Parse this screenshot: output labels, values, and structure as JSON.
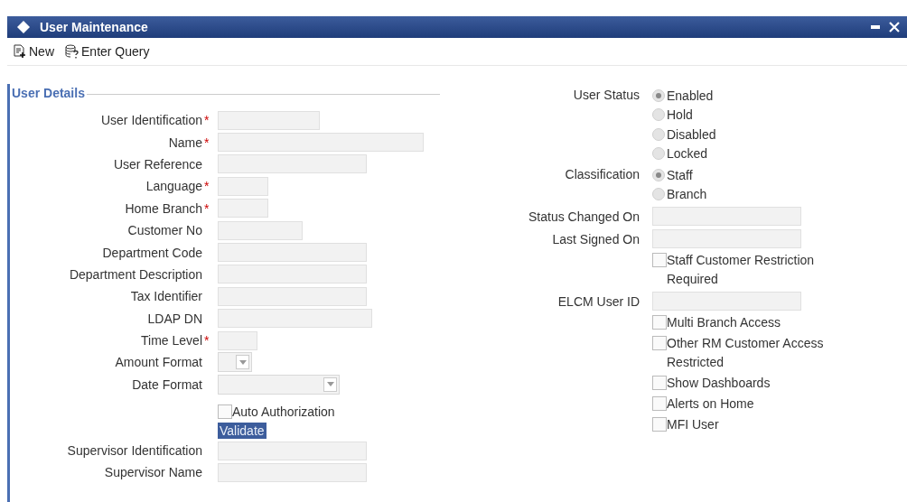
{
  "window": {
    "title": "User Maintenance"
  },
  "toolbar": [
    {
      "kind": "new",
      "label": "New"
    },
    {
      "kind": "query",
      "label": "Enter Query"
    }
  ],
  "section": {
    "title": "User Details"
  },
  "left_fields": [
    {
      "kind": "text",
      "label": "User Identification",
      "required_mark": "*"
    },
    {
      "kind": "text",
      "label": "Name",
      "required_mark": "*"
    },
    {
      "kind": "text",
      "label": "User Reference"
    },
    {
      "kind": "text",
      "label": "Language",
      "required_mark": "*"
    },
    {
      "kind": "text",
      "label": "Home Branch",
      "required_mark": "*"
    },
    {
      "kind": "text",
      "label": "Customer No"
    },
    {
      "kind": "text",
      "label": "Department Code"
    },
    {
      "kind": "text",
      "label": "Department Description"
    },
    {
      "kind": "text",
      "label": "Tax Identifier"
    },
    {
      "kind": "text",
      "label": "LDAP DN"
    },
    {
      "kind": "text",
      "label": "Time Level",
      "required_mark": "*"
    },
    {
      "kind": "select",
      "label": "Amount Format"
    },
    {
      "kind": "select",
      "label": "Date Format"
    },
    {
      "kind": "checkbox",
      "label": "Auto Authorization",
      "checked": false
    },
    {
      "kind": "button",
      "label": "Validate"
    },
    {
      "kind": "text",
      "label": "Supervisor Identification"
    },
    {
      "kind": "text",
      "label": "Supervisor Name"
    }
  ],
  "right_fields": [
    {
      "kind": "radio",
      "label": "User Status",
      "options": [
        {
          "label": "Enabled",
          "selected": true
        },
        {
          "label": "Hold",
          "selected": false
        },
        {
          "label": "Disabled",
          "selected": false
        },
        {
          "label": "Locked",
          "selected": false
        }
      ]
    },
    {
      "kind": "radio",
      "label": "Classification",
      "options": [
        {
          "label": "Staff",
          "selected": true
        },
        {
          "label": "Branch",
          "selected": false
        }
      ]
    },
    {
      "kind": "text",
      "label": "Status Changed On"
    },
    {
      "kind": "text",
      "label": "Last Signed On"
    },
    {
      "kind": "checkbox",
      "label": "Staff Customer Restriction Required",
      "checked": false
    },
    {
      "kind": "text",
      "label": "ELCM User ID"
    },
    {
      "kind": "checkbox",
      "label": "Multi Branch Access",
      "checked": false
    },
    {
      "kind": "checkbox",
      "label": "Other RM Customer Access Restricted",
      "checked": false
    },
    {
      "kind": "checkbox",
      "label": "Show Dashboards",
      "checked": false
    },
    {
      "kind": "checkbox",
      "label": "Alerts on Home",
      "checked": false
    },
    {
      "kind": "checkbox",
      "label": "MFI User",
      "checked": false
    }
  ]
}
